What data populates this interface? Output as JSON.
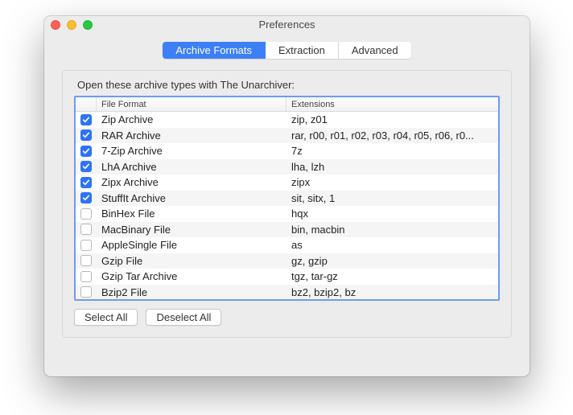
{
  "window": {
    "title": "Preferences"
  },
  "tabs": [
    {
      "label": "Archive Formats",
      "selected": true
    },
    {
      "label": "Extraction",
      "selected": false
    },
    {
      "label": "Advanced",
      "selected": false
    }
  ],
  "instruction": "Open these archive types with The Unarchiver:",
  "columns": {
    "format": "File Format",
    "extensions": "Extensions"
  },
  "formats": [
    {
      "checked": true,
      "name": "Zip Archive",
      "ext": "zip, z01"
    },
    {
      "checked": true,
      "name": "RAR Archive",
      "ext": "rar, r00, r01, r02, r03, r04, r05, r06, r0..."
    },
    {
      "checked": true,
      "name": "7-Zip Archive",
      "ext": "7z"
    },
    {
      "checked": true,
      "name": "LhA Archive",
      "ext": "lha, lzh"
    },
    {
      "checked": true,
      "name": "Zipx Archive",
      "ext": "zipx"
    },
    {
      "checked": true,
      "name": "StuffIt Archive",
      "ext": "sit, sitx, 1"
    },
    {
      "checked": false,
      "name": "BinHex File",
      "ext": "hqx"
    },
    {
      "checked": false,
      "name": "MacBinary File",
      "ext": "bin, macbin"
    },
    {
      "checked": false,
      "name": "AppleSingle File",
      "ext": "as"
    },
    {
      "checked": false,
      "name": "Gzip File",
      "ext": "gz, gzip"
    },
    {
      "checked": false,
      "name": "Gzip Tar Archive",
      "ext": "tgz, tar-gz"
    },
    {
      "checked": false,
      "name": "Bzip2 File",
      "ext": "bz2, bzip2, bz"
    }
  ],
  "buttons": {
    "select_all": "Select All",
    "deselect_all": "Deselect All"
  }
}
